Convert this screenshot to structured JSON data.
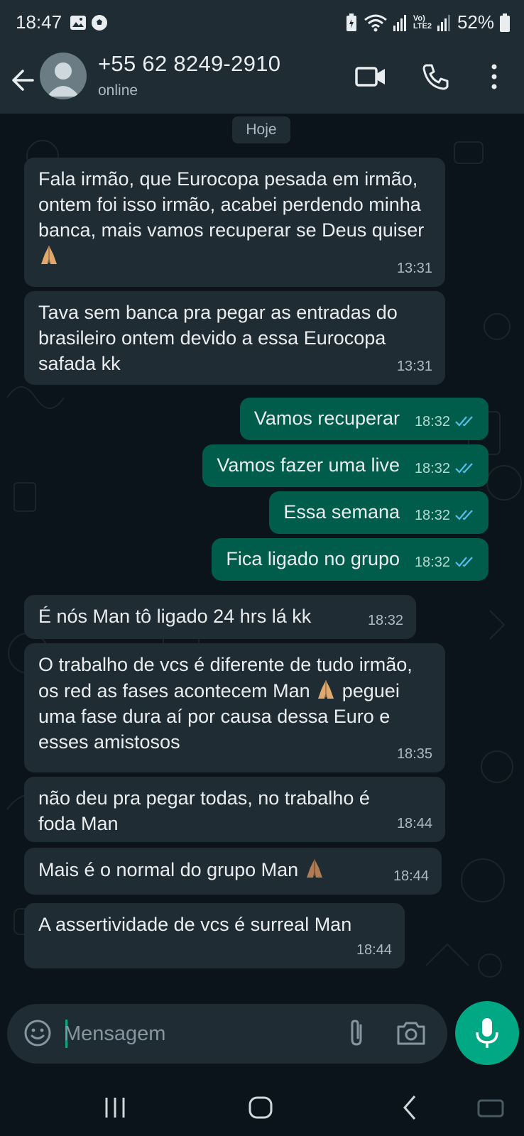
{
  "status_bar": {
    "time": "18:47",
    "battery": "52%",
    "network_label": "Vo)\nLTE2"
  },
  "header": {
    "contact_name": "+55 62 8249-2910",
    "contact_status": "online"
  },
  "chat": {
    "day_chip": "Hoje",
    "messages": [
      {
        "direction": "in",
        "text": "Fala irmão, que Eurocopa pesada em irmão, ontem foi isso irmão, acabei perdendo minha banca, mais vamos recuperar se Deus quiser",
        "emoji": "folded-hands",
        "time": "13:31"
      },
      {
        "direction": "in",
        "text": "Tava sem banca pra pegar as entradas do brasileiro ontem devido a essa Eurocopa safada kk",
        "time": "13:31"
      },
      {
        "direction": "out",
        "text": "Vamos recuperar",
        "time": "18:32",
        "status": "read"
      },
      {
        "direction": "out",
        "text": "Vamos fazer uma live",
        "time": "18:32",
        "status": "read"
      },
      {
        "direction": "out",
        "text": "Essa semana",
        "time": "18:32",
        "status": "read"
      },
      {
        "direction": "out",
        "text": "Fica ligado no grupo",
        "time": "18:32",
        "status": "read"
      },
      {
        "direction": "in",
        "text": "É nós Man tô ligado 24 hrs lá kk",
        "time": "18:32"
      },
      {
        "direction": "in",
        "text_a": "O trabalho de vcs é diferente de tudo irmão, os red as fases acontecem Man",
        "text_b": "peguei uma fase dura aí por causa dessa Euro e esses amistosos",
        "emoji": "folded-hands",
        "time": "18:35"
      },
      {
        "direction": "in",
        "text": "não deu pra pegar todas, no trabalho é foda Man",
        "time": "18:44"
      },
      {
        "direction": "in",
        "text": "Mais é o normal do grupo Man",
        "emoji": "folded-hands",
        "time": "18:44"
      },
      {
        "direction": "in",
        "text": "A assertividade de vcs é surreal Man",
        "time": "18:44"
      }
    ]
  },
  "composer": {
    "placeholder": "Mensagem"
  },
  "icons": {
    "back": "arrow-left-icon",
    "video": "video-camera-icon",
    "call": "phone-icon",
    "menu": "more-vert-icon",
    "emoji": "emoji-icon",
    "attach": "paperclip-icon",
    "camera": "camera-icon",
    "mic": "mic-icon"
  },
  "colors": {
    "background": "#0b141a",
    "header": "#1f2c34",
    "incoming_bubble": "#202c33",
    "outgoing_bubble": "#005c4b",
    "accent": "#00a884",
    "read_tick": "#53bdeb"
  }
}
